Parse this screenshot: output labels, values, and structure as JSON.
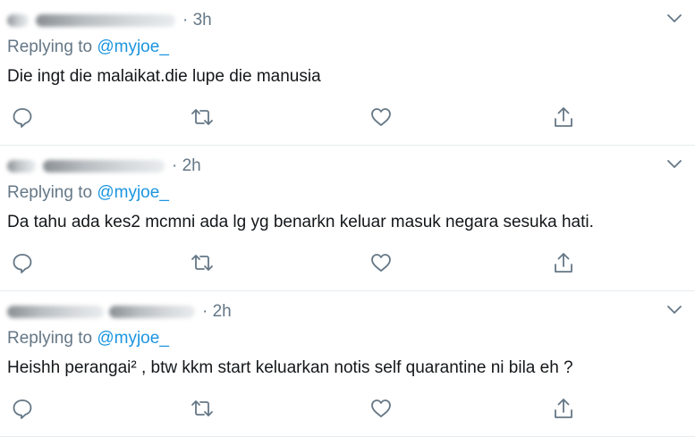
{
  "tweets": [
    {
      "timestamp": "· 3h",
      "replying_prefix": "Replying to",
      "replying_handle": "@myjoe_",
      "text": "Die ingt die malaikat.die lupe die manusia"
    },
    {
      "timestamp": "· 2h",
      "replying_prefix": "Replying to",
      "replying_handle": "@myjoe_",
      "text": "Da tahu ada kes2 mcmni ada lg yg benarkn keluar masuk negara sesuka hati."
    },
    {
      "timestamp": "· 2h",
      "replying_prefix": "Replying to",
      "replying_handle": "@myjoe_",
      "text": "Heishh perangai² , btw kkm start keluarkan notis self quarantine ni bila eh ?"
    }
  ],
  "icons": {
    "reply": "reply-icon",
    "retweet": "retweet-icon",
    "like": "like-icon",
    "share": "share-icon",
    "more": "chevron-down-icon"
  },
  "colors": {
    "secondary_text": "#657786",
    "link": "#1b95e0",
    "primary_text": "#14171a",
    "divider": "#e6ecf0"
  }
}
